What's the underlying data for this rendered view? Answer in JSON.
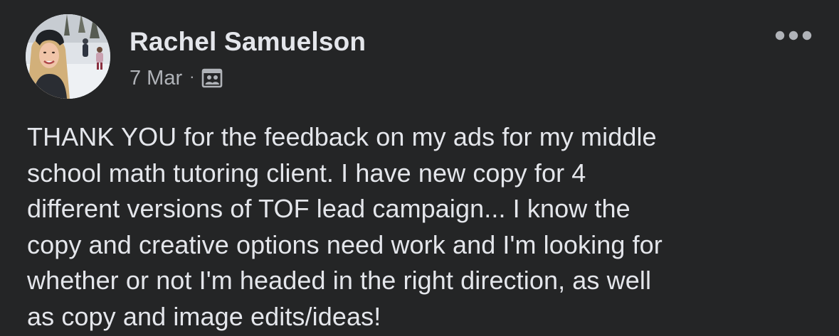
{
  "post": {
    "author_name": "Rachel Samuelson",
    "timestamp": "7 Mar",
    "separator": "·",
    "audience_icon": "group-members-icon",
    "more_icon": "more-options-icon",
    "avatar_icon": "profile-photo",
    "body_lines": [
      "THANK YOU for the feedback on my ads for my middle",
      "school math tutoring client. I have new copy for 4",
      "different versions of TOF lead campaign... I know the",
      "copy and creative options need work and I'm looking for",
      "whether or not I'm headed in the right direction, as well",
      "as copy and image edits/ideas!"
    ]
  },
  "colors": {
    "background": "#242526",
    "primary_text": "#e4e6eb",
    "secondary_text": "#b0b3b8"
  }
}
